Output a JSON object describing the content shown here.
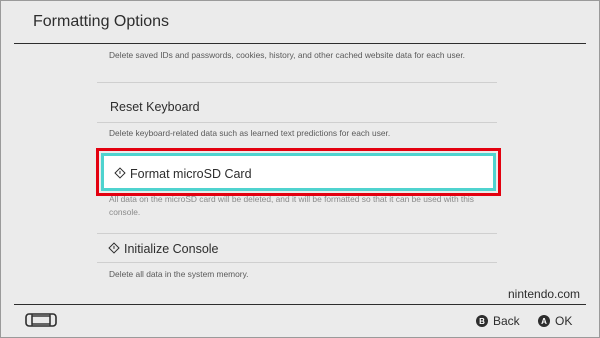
{
  "header": {
    "title": "Formatting Options"
  },
  "items": {
    "clear_cache_desc": "Delete saved IDs and passwords, cookies, history, and other cached website data for each user.",
    "reset_keyboard": {
      "label": "Reset Keyboard",
      "desc": "Delete keyboard-related data such as learned text predictions for each user."
    },
    "format_sd": {
      "label": "Format microSD Card",
      "icon": "warning-diamond-icon",
      "desc": "All data on the microSD card will be deleted, and it will be formatted so that it can be used with this console."
    },
    "initialize_console": {
      "label": "Initialize Console",
      "icon": "warning-diamond-icon",
      "desc": "Delete all data in the system memory."
    }
  },
  "watermark": "nintendo.com",
  "footer": {
    "console_icon": "switch-console-icon",
    "back_button_glyph": "B",
    "back_label": "Back",
    "ok_button_glyph": "A",
    "ok_label": "OK"
  },
  "colors": {
    "background": "#ebebeb",
    "selection_cyan": "#4fd3cf",
    "highlight_red": "#e3000f",
    "text": "#2d2d2d"
  }
}
